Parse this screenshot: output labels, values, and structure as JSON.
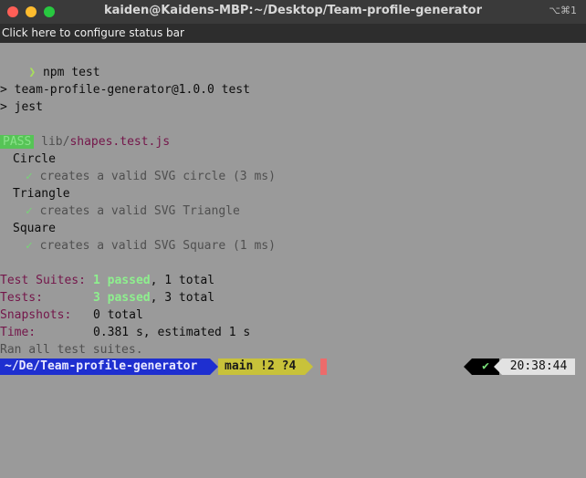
{
  "window": {
    "title": "kaiden@Kaidens-MBP:~/Desktop/Team-profile-generator",
    "shortcut": "⌥⌘1",
    "traffic_light_colors": [
      "#ff5f57",
      "#febc2e",
      "#28c840"
    ]
  },
  "status_bar": {
    "label": "Click here to configure status bar"
  },
  "terminal": {
    "prompt_symbol": "❯",
    "command": "npm test",
    "script_header": "> team-profile-generator@1.0.0 test",
    "script_cmd": "> jest",
    "result_badge": "PASS",
    "file_dir": "lib/",
    "file_name": "shapes.test.js",
    "suites": [
      {
        "name": "Circle",
        "check": "✓",
        "test": "creates a valid SVG circle (3 ms)"
      },
      {
        "name": "Triangle",
        "check": "✓",
        "test": "creates a valid SVG Triangle"
      },
      {
        "name": "Square",
        "check": "✓",
        "test": "creates a valid SVG Square (1 ms)"
      }
    ],
    "summary": {
      "suites_label": "Test Suites:",
      "suites_passed": "1 passed",
      "suites_total": ", 1 total",
      "tests_label": "Tests:",
      "tests_passed": "3 passed",
      "tests_total": ", 3 total",
      "snapshots_label": "Snapshots:",
      "snapshots_value": "0 total",
      "time_label": "Time:",
      "time_value": "0.381 s, estimated 1 s"
    },
    "ran_all": "Ran all test suites."
  },
  "powerline": {
    "path": "~/De/Team-profile-generator",
    "branch": "main !2 ?4",
    "status_check": "✔",
    "time": "20:38:44",
    "colors": {
      "path_bg": "#1e2fd0",
      "git_bg": "#c8c23a",
      "cursor": "#ec6b6b",
      "status_bg": "#000000",
      "time_bg": "#e2e2e2"
    }
  }
}
